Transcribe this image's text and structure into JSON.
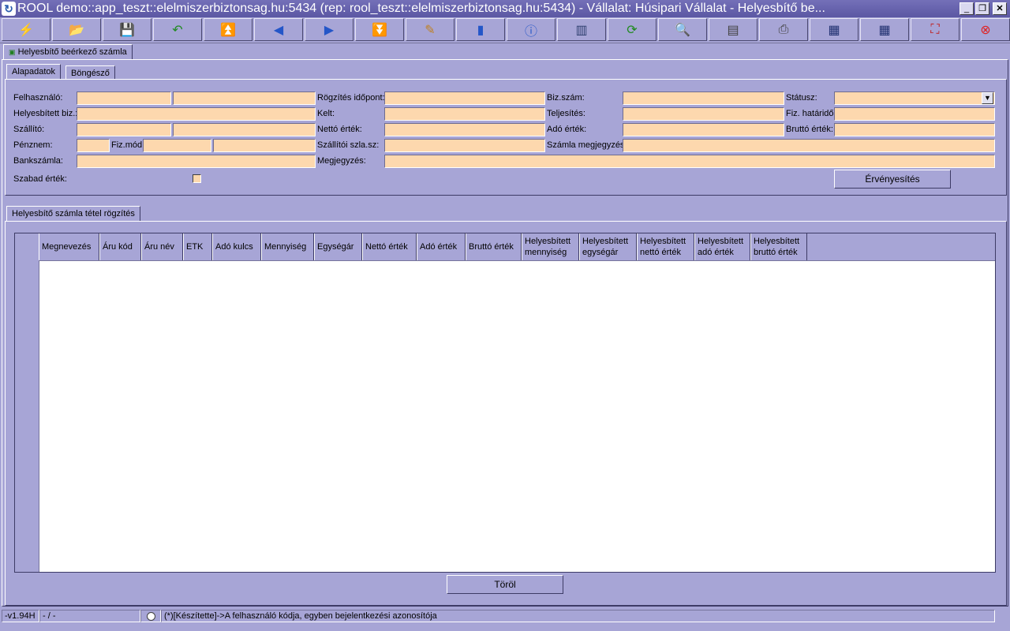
{
  "window": {
    "title": "ROOL demo::app_teszt::elelmiszerbiztonsag.hu:5434 (rep: rool_teszt::elelmiszerbiztonsag.hu:5434) - Vállalat: Húsipari Vállalat - Helyesbítő be...",
    "minimize": "_",
    "restore": "❐",
    "close": "✕"
  },
  "toolbar": {
    "icons": [
      "lightning-icon",
      "open-folder-icon",
      "save-icon",
      "undo-icon",
      "first-record-icon",
      "prev-record-icon",
      "next-record-icon",
      "last-record-icon",
      "edit-icon",
      "database-icon",
      "info-icon",
      "columns-icon",
      "refresh-icon",
      "search-icon",
      "table-icon",
      "print-icon",
      "grid-export-icon",
      "grid-import-icon",
      "grid-settings-icon",
      "fullscreen-icon",
      "exit-icon"
    ]
  },
  "doc_tab": {
    "label": "Helyesbítő beérkező számla"
  },
  "tabs": {
    "basic": "Alapadatok",
    "browser": "Böngésző"
  },
  "form": {
    "felhasznalo": "Felhasználó:",
    "helyesbitett_biz": "Helyesbített biz.:",
    "szallito": "Szállító:",
    "penznem": "Pénznem:",
    "fiz_mod": "Fiz.mód:",
    "bankszamla": "Bankszámla:",
    "szabad_ertek": "Szabad érték:",
    "rogzites_idopont": "Rögzítés időpont:",
    "kelt": "Kelt:",
    "netto_ertek": "Nettó érték:",
    "szallitoi_szla_sz": "Szállítói szla.sz:",
    "megjegyzes": "Megjegyzés:",
    "biz_szam": "Biz.szám:",
    "teljesites": "Teljesítés:",
    "ado_ertek": "Adó érték:",
    "szamla_megjegyzes": "Számla megjegyzés:",
    "statusz": "Státusz:",
    "fiz_hatarido": "Fiz. határidő:",
    "brutto_ertek": "Bruttó érték:",
    "statusz_dropdown": "▼",
    "ervenyesites": "Érvényesítés"
  },
  "items": {
    "tab": "Helyesbítő számla tétel rögzítés",
    "columns": [
      "Megnevezés",
      "Áru kód",
      "Áru név",
      "ETK",
      "Adó kulcs",
      "Mennyiség",
      "Egységár",
      "Nettó érték",
      "Adó érték",
      "Bruttó érték",
      "Helyesbített mennyiség",
      "Helyesbített egységár",
      "Helyesbített nettó érték",
      "Helyesbített adó érték",
      "Helyesbített bruttó érték"
    ],
    "torol": "Töröl"
  },
  "status": {
    "version": "-v1.94H",
    "record": "- / -",
    "message": "(*)[Készítette]->A felhasználó kódja, egyben bejelentkezési azonosítója"
  }
}
